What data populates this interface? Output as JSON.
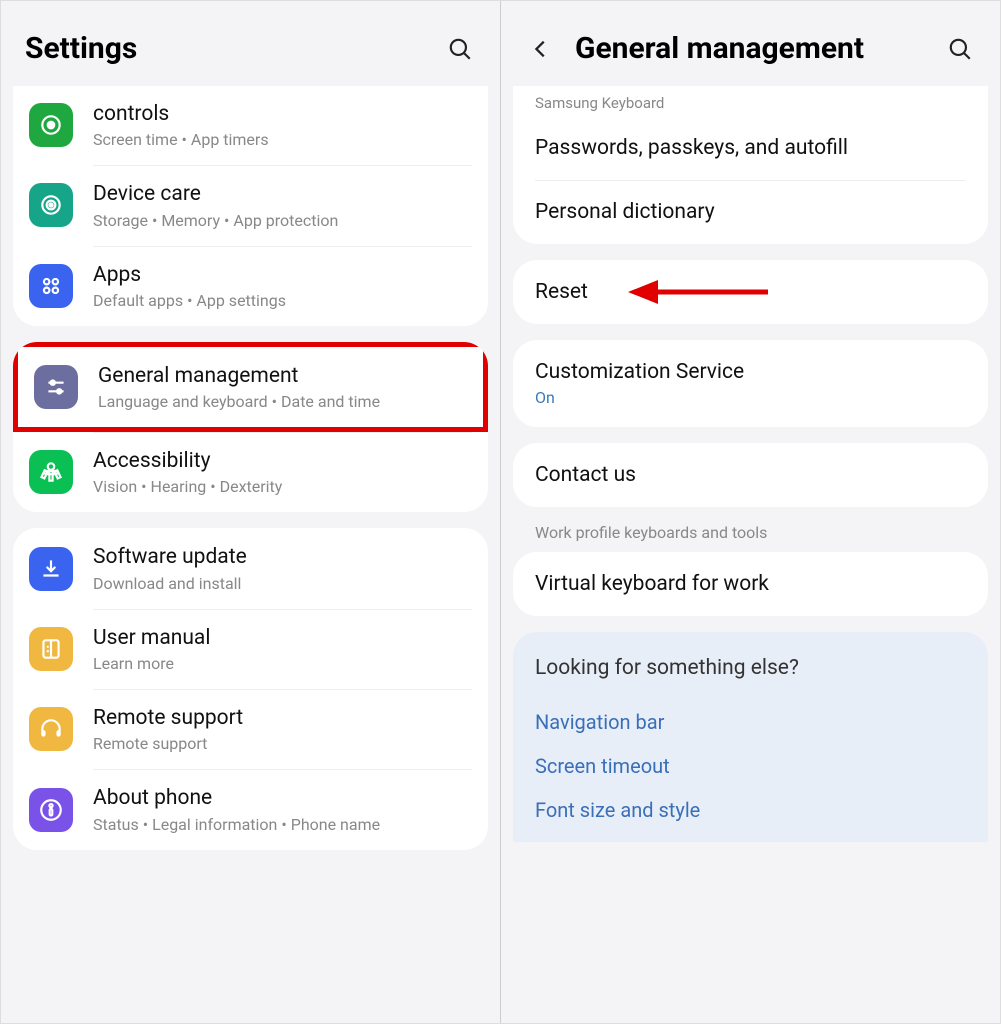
{
  "left": {
    "title": "Settings",
    "groups": [
      {
        "items": [
          {
            "id": "digital-wellbeing",
            "title": "controls",
            "sub": "Screen time  •  App timers",
            "color": "icon-green",
            "icon": "target-icon"
          },
          {
            "id": "device-care",
            "title": "Device care",
            "sub": "Storage  •  Memory  •  App protection",
            "color": "icon-teal",
            "icon": "radar-icon"
          },
          {
            "id": "apps",
            "title": "Apps",
            "sub": "Default apps  •  App settings",
            "color": "icon-blue",
            "icon": "grid-icon"
          }
        ]
      },
      {
        "items": [
          {
            "id": "general-management",
            "title": "General management",
            "sub": "Language and keyboard  •  Date and time",
            "color": "icon-purple",
            "icon": "sliders-icon",
            "highlight": true
          },
          {
            "id": "accessibility",
            "title": "Accessibility",
            "sub": "Vision  •  Hearing  •  Dexterity",
            "color": "icon-green2",
            "icon": "person-icon"
          }
        ]
      },
      {
        "items": [
          {
            "id": "software-update",
            "title": "Software update",
            "sub": "Download and install",
            "color": "icon-blue2",
            "icon": "download-icon"
          },
          {
            "id": "user-manual",
            "title": "User manual",
            "sub": "Learn more",
            "color": "icon-yellow",
            "icon": "book-icon"
          },
          {
            "id": "remote-support",
            "title": "Remote support",
            "sub": "Remote support",
            "color": "icon-yellow2",
            "icon": "headset-icon"
          },
          {
            "id": "about-phone",
            "title": "About phone",
            "sub": "Status  •  Legal information  •  Phone name",
            "color": "icon-violet",
            "icon": "info-icon"
          }
        ]
      }
    ]
  },
  "right": {
    "title": "General management",
    "top_hint": "Samsung Keyboard",
    "group1": [
      {
        "id": "passwords",
        "title": "Passwords, passkeys, and autofill"
      },
      {
        "id": "dictionary",
        "title": "Personal dictionary"
      }
    ],
    "group2": [
      {
        "id": "reset",
        "title": "Reset",
        "arrow": true
      }
    ],
    "group3": [
      {
        "id": "customization",
        "title": "Customization Service",
        "value": "On"
      }
    ],
    "group4": [
      {
        "id": "contact",
        "title": "Contact us"
      }
    ],
    "section_label": "Work profile keyboards and tools",
    "group5": [
      {
        "id": "virtual-keyboard-work",
        "title": "Virtual keyboard for work"
      }
    ],
    "suggest": {
      "title": "Looking for something else?",
      "links": [
        "Navigation bar",
        "Screen timeout",
        "Font size and style"
      ]
    }
  }
}
